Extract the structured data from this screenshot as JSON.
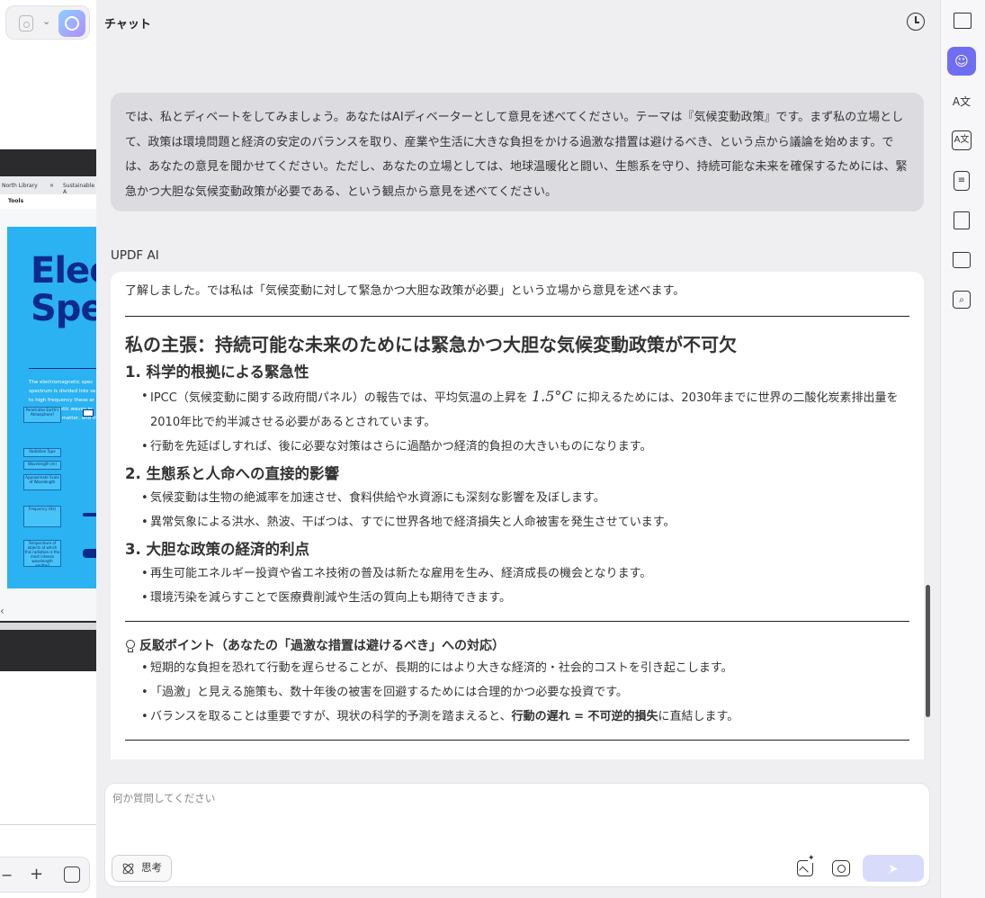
{
  "left_panel": {
    "tab1": "North Library",
    "tab1_close": "×",
    "tab2": "Sustainable A",
    "tools": "Tools",
    "poster_title": "Elec\nSpe",
    "poster_text": "The electromagnetic spec\nspectrum is divided into se\nto high frequency these ar\nelectromagnetic waves in\ninteract with matter, and th",
    "labels": [
      "Penetrates Earth's Atmosphere?",
      "Radiation Type",
      "Wavelength (m)",
      "Approximate Scale of Wavelength",
      "Frequency (Hz)",
      "Temperature of objects at which this radiation is the most intense wavelength emitted"
    ],
    "chevron": "⌄",
    "nav_arrow": "‹",
    "zoom_minus": "−",
    "zoom_plus": "+"
  },
  "header": {
    "title": "チャット"
  },
  "user_message": "では、私とディベートをしてみましょう。あなたはAIディベーターとして意見を述べてください。テーマは『気候変動政策』です。まず私の立場として、政策は環境問題と経済の安定のバランスを取り、産業や生活に大きな負担をかける過激な措置は避けるべき、という点から議論を始めます。では、あなたの意見を聞かせてください。ただし、あなたの立場としては、地球温暖化と闘い、生態系を守り、持続可能な未来を確保するためには、緊急かつ大胆な気候変動政策が必要である、という観点から意見を述べてください。",
  "ai_label": "UPDF AI",
  "ai_message": {
    "intro": "了解しました。では私は「気候変動に対して緊急かつ大胆な政策が必要」という立場から意見を述べます。",
    "heading": "私の主張：持続可能な未来のためには緊急かつ大胆な気候変動政策が不可欠",
    "s1_title": "1. 科学的根拠による緊急性",
    "s1_b1_pre": "IPCC（気候変動に関する政府間パネル）の報告では、平均気温の上昇を",
    "s1_b1_math": "1.5°C",
    "s1_b1_post": "に抑えるためには、2030年までに世界の二酸化炭素排出量を2010年比で約半減させる必要があるとされています。",
    "s1_b2": "行動を先延ばしすれば、後に必要な対策はさらに過酷かつ経済的負担の大きいものになります。",
    "s2_title": "2. 生態系と人命への直接的影響",
    "s2_b1": "気候変動は生物の絶滅率を加速させ、食料供給や水資源にも深刻な影響を及ぼします。",
    "s2_b2": "異常気象による洪水、熱波、干ばつは、すでに世界各地で経済損失と人命被害を発生させています。",
    "s3_title": "3. 大胆な政策の経済的利点",
    "s3_b1": "再生可能エネルギー投資や省エネ技術の普及は新たな雇用を生み、経済成長の機会となります。",
    "s3_b2": "環境汚染を減らすことで医療費削減や生活の質向上も期待できます。",
    "rebuttal_title": "反駁ポイント（あなたの「過激な措置は避けるべき」への対応）",
    "r_b1": "短期的な負担を恐れて行動を遅らせることが、長期的にはより大きな経済的・社会的コストを引き起こします。",
    "r_b2": "「過激」と見える施策も、数十年後の被害を回避するためには合理的かつ必要な投資です。",
    "r_b3_pre": "バランスを取ることは重要ですが、現状の科学的予測を踏まえると、",
    "r_b3_bold": "行動の遅れ = 不可逆的損失",
    "r_b3_post": "に直結します。"
  },
  "input": {
    "placeholder": "何か質問してください",
    "think_label": "思考",
    "send_icon": "➤"
  },
  "right_bar": {
    "icons": [
      "book-sparkle-icon",
      "chat-ai-icon",
      "translate-icon",
      "ocr-translate-icon",
      "summary-icon",
      "knowledge-book-icon",
      "folder-add-icon",
      "search-ai-icon"
    ],
    "translate_glyph": "A文",
    "active_color": "#6f6ef2"
  }
}
